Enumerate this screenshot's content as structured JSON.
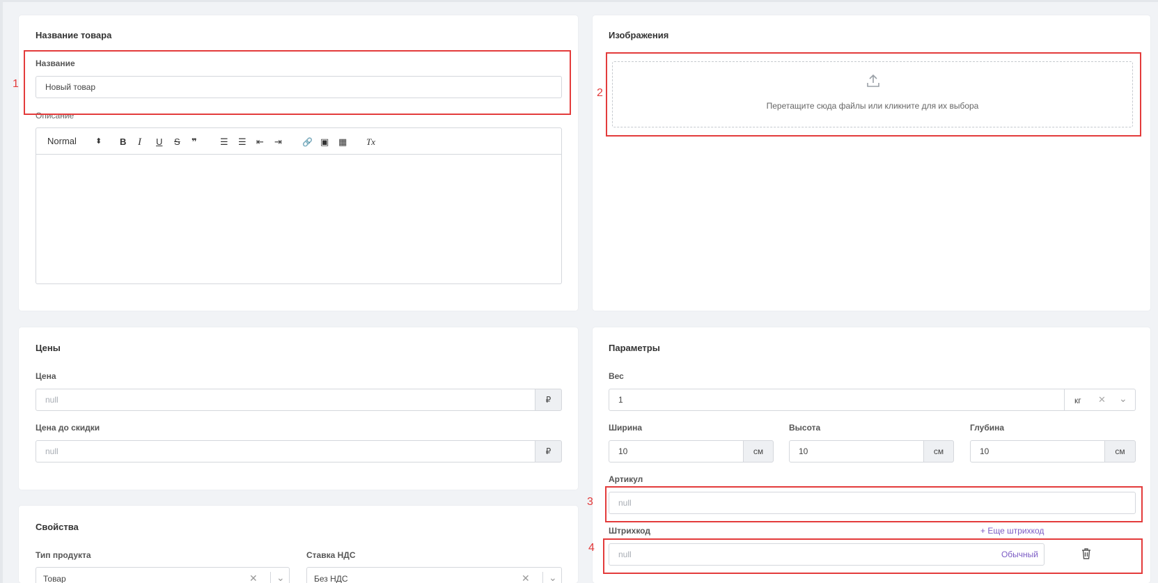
{
  "product_name": {
    "title": "Название товара",
    "name_label": "Название",
    "name_value": "Новый товар",
    "description_label": "Описание",
    "editor": {
      "format_select": "Normal",
      "format_arrows": "⬍",
      "bold": "B",
      "italic": "I",
      "underline": "U",
      "strike": "S",
      "quote": "❞",
      "ordered_list": "☰",
      "bullet_list": "☰",
      "outdent": "⇤",
      "indent": "⇥",
      "link": "🔗",
      "image": "▣",
      "video": "▦",
      "clear_format": "Tx"
    }
  },
  "images": {
    "title": "Изображения",
    "upload_icon": "upload-icon",
    "dropzone_text": "Перетащите сюда файлы или кликните для их выбора"
  },
  "prices": {
    "title": "Цены",
    "price_label": "Цена",
    "price_placeholder": "null",
    "price_currency": "₽",
    "old_price_label": "Цена до скидки",
    "old_price_placeholder": "null",
    "old_price_currency": "₽"
  },
  "parameters": {
    "title": "Параметры",
    "weight_label": "Вес",
    "weight_value": "1",
    "weight_unit": "кг",
    "width_label": "Ширина",
    "width_value": "10",
    "width_unit": "см",
    "height_label": "Высота",
    "height_value": "10",
    "height_unit": "см",
    "depth_label": "Глубина",
    "depth_value": "10",
    "depth_unit": "см",
    "article_label": "Артикул",
    "article_placeholder": "null",
    "barcode_label": "Штрихкод",
    "barcode_add_link": "+ Еще штрихкод",
    "barcode_placeholder": "null",
    "barcode_type": "Обычный"
  },
  "properties": {
    "title": "Свойства",
    "product_type_label": "Тип продукта",
    "product_type_value": "Товар",
    "vat_label": "Ставка НДС",
    "vat_value": "Без НДС"
  },
  "annotations": [
    "1",
    "2",
    "3",
    "4"
  ],
  "colors": {
    "highlight": "#e33b3b",
    "link": "#7b5bc4",
    "background": "#f1f3f6"
  }
}
